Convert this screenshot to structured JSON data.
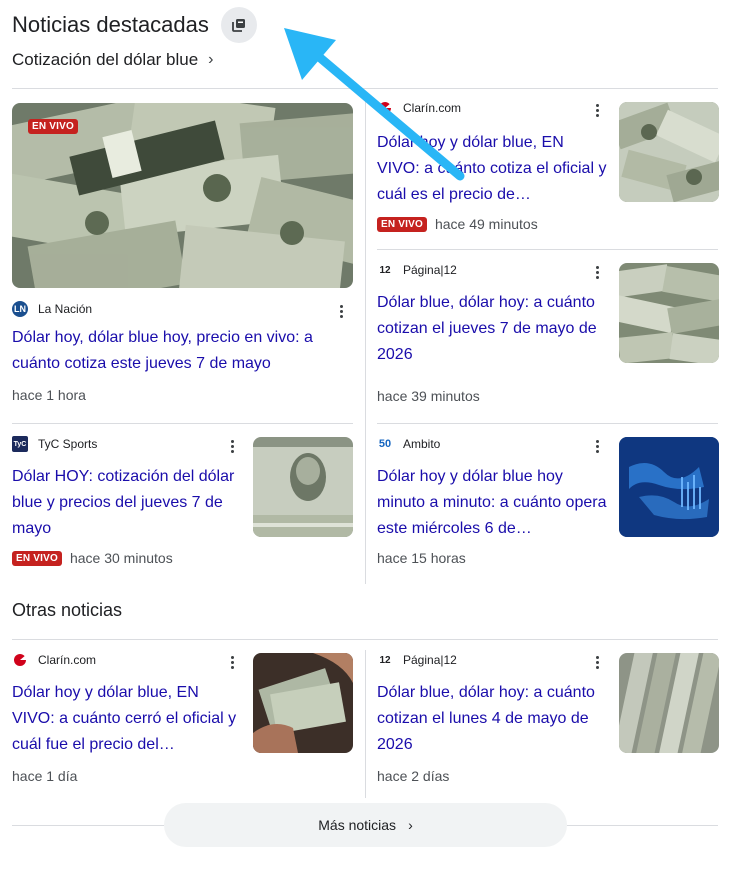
{
  "header": {
    "title": "Noticias destacadas",
    "icon": "stack-icon"
  },
  "topic": {
    "label": "Cotización del dólar blue",
    "chevron": "›"
  },
  "featured": {
    "live_badge": "EN VIVO",
    "source": "La Nación",
    "headline": "Dólar hoy, dólar blue hoy, precio en vivo: a cuánto cotiza este jueves 7 de mayo",
    "time": "hace 1 hora"
  },
  "right_stories": [
    {
      "source": "Clarín.com",
      "headline": "Dólar hoy y dólar blue, EN VIVO: a cuánto cotiza el oficial y cuál es el precio de…",
      "live_badge": "EN VIVO",
      "time": "hace 49 minutos"
    },
    {
      "source": "Página|12",
      "headline": "Dólar blue, dólar hoy: a cuánto cotizan el jueves 7 de mayo de 2026",
      "time": "hace 39 minutos"
    },
    {
      "source": "Ambito",
      "headline": "Dólar hoy y dólar blue hoy minuto a minuto: a cuánto opera este miércoles 6 de…",
      "time": "hace 15 horas"
    }
  ],
  "tyc_story": {
    "source": "TyC Sports",
    "headline": "Dólar HOY: cotización del dólar blue y precios del jueves 7 de mayo",
    "live_badge": "EN VIVO",
    "time": "hace 30 minutos"
  },
  "other": {
    "title": "Otras noticias",
    "stories": [
      {
        "source": "Clarín.com",
        "headline": "Dólar hoy y dólar blue, EN VIVO: a cuánto cerró el oficial y cuál fue el precio del…",
        "time": "hace 1 día"
      },
      {
        "source": "Página|12",
        "headline": "Dólar blue, dólar hoy: a cuánto cotizan el lunes 4 de mayo de 2026",
        "time": "hace 2 días"
      }
    ]
  },
  "more_button": {
    "label": "Más noticias",
    "chevron": "›"
  },
  "colors": {
    "link": "#1a0dab",
    "live": "#c5221f",
    "annotation_arrow": "#29b6f6"
  }
}
